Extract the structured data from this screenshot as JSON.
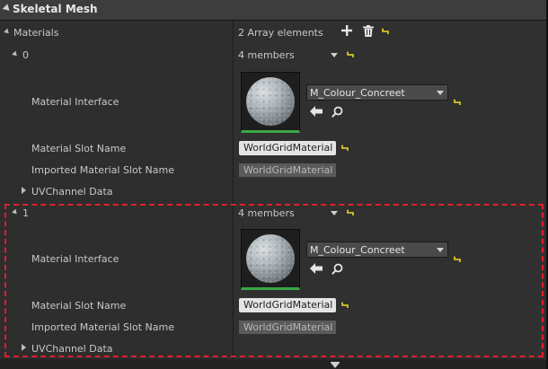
{
  "header": {
    "title": "Skeletal Mesh"
  },
  "materials": {
    "label": "Materials",
    "count_text": "2 Array elements",
    "add_icon": "plus-icon",
    "delete_icon": "trash-icon",
    "reset_icon": "reset-arrow-icon"
  },
  "elements": [
    {
      "index": "0",
      "members_text": "4 members",
      "material_interface_label": "Material Interface",
      "material_value": "M_Colour_Concreet",
      "slot_name_label": "Material Slot Name",
      "slot_name_value": "WorldGridMaterial",
      "imported_slot_label": "Imported Material Slot Name",
      "imported_slot_value": "WorldGridMaterial",
      "uv_label": "UVChannel Data"
    },
    {
      "index": "1",
      "members_text": "4 members",
      "material_interface_label": "Material Interface",
      "material_value": "M_Colour_Concreet",
      "slot_name_label": "Material Slot Name",
      "slot_name_value": "WorldGridMaterial",
      "imported_slot_label": "Imported Material Slot Name",
      "imported_slot_value": "WorldGridMaterial",
      "uv_label": "UVChannel Data"
    }
  ],
  "colors": {
    "thumbnail_border": "#3aa845",
    "selection_outline": "#e0202e",
    "reset_icon": "#f0e020"
  }
}
